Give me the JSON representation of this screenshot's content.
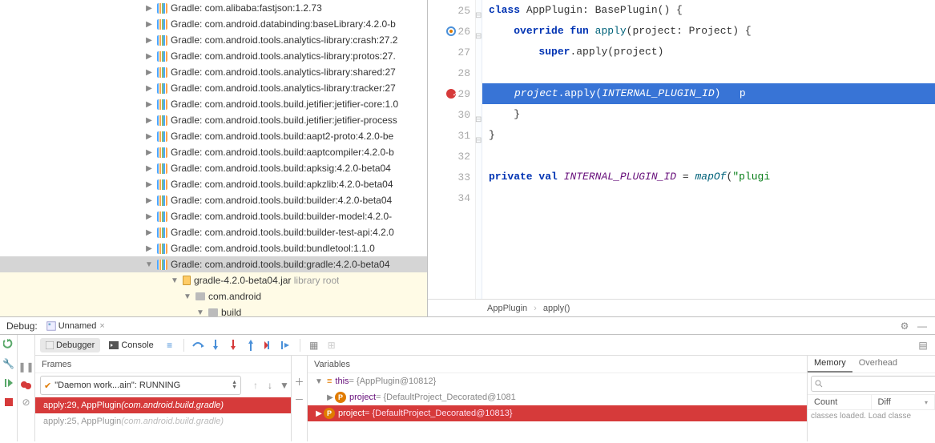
{
  "tree": {
    "items": [
      "Gradle: com.alibaba:fastjson:1.2.73",
      "Gradle: com.android.databinding:baseLibrary:4.2.0-b",
      "Gradle: com.android.tools.analytics-library:crash:27.2",
      "Gradle: com.android.tools.analytics-library:protos:27.",
      "Gradle: com.android.tools.analytics-library:shared:27",
      "Gradle: com.android.tools.analytics-library:tracker:27",
      "Gradle: com.android.tools.build.jetifier:jetifier-core:1.0",
      "Gradle: com.android.tools.build.jetifier:jetifier-process",
      "Gradle: com.android.tools.build:aapt2-proto:4.2.0-be",
      "Gradle: com.android.tools.build:aaptcompiler:4.2.0-b",
      "Gradle: com.android.tools.build:apksig:4.2.0-beta04",
      "Gradle: com.android.tools.build:apkzlib:4.2.0-beta04",
      "Gradle: com.android.tools.build:builder:4.2.0-beta04",
      "Gradle: com.android.tools.build:builder-model:4.2.0-",
      "Gradle: com.android.tools.build:builder-test-api:4.2.0",
      "Gradle: com.android.tools.build:bundletool:1.1.0"
    ],
    "selected": "Gradle: com.android.tools.build:gradle:4.2.0-beta04",
    "jar": "gradle-4.2.0-beta04.jar",
    "jar_suffix": "library root",
    "pkg": "com.android",
    "folder": "build"
  },
  "lines": [
    "25",
    "26",
    "27",
    "28",
    "29",
    "30",
    "31",
    "32",
    "33",
    "34"
  ],
  "code": {
    "l25_a": "class",
    "l25_b": " AppPlugin: BasePlugin() {",
    "l26_a": "override fun",
    "l26_b": " ",
    "l26_c": "apply",
    "l26_d": "(project: Project) {",
    "l27_a": "super",
    "l27_b": ".apply(project)",
    "l29_a": "project",
    "l29_b": ".apply(",
    "l29_c": "INTERNAL_PLUGIN_ID",
    "l29_d": ")   p",
    "l30": "}",
    "l31": "}",
    "l33_a": "private val",
    "l33_b": " ",
    "l33_c": "INTERNAL_PLUGIN_ID",
    "l33_d": " = ",
    "l33_e": "mapOf",
    "l33_f": "(",
    "l33_g": "\"plugi"
  },
  "breadcrumb": {
    "a": "AppPlugin",
    "b": "apply()"
  },
  "debug": {
    "title": "Debug:",
    "config": "Unnamed",
    "tabs": {
      "debugger": "Debugger",
      "console": "Console"
    },
    "frames_label": "Frames",
    "thread": "\"Daemon work...ain\": RUNNING",
    "frame1_a": "apply:29, AppPlugin ",
    "frame1_b": "(com.android.build.gradle)",
    "frame2_a": "apply:25, AppPlugin ",
    "frame2_b": "(com.android.build.gradle)",
    "vars_label": "Variables",
    "var_this_a": "this",
    "var_this_b": " = {AppPlugin@10812}",
    "var_proj_a": "project",
    "var_proj_b": " = {DefaultProject_Decorated@1081",
    "var_sel_a": "project",
    "var_sel_b": " = {DefaultProject_Decorated@10813} ",
    "mem_tabs": {
      "memory": "Memory",
      "overhead": "Overhead"
    },
    "mem_cols": {
      "count": "Count",
      "diff": "Diff"
    },
    "mem_foot": "classes loaded. Load classe"
  }
}
